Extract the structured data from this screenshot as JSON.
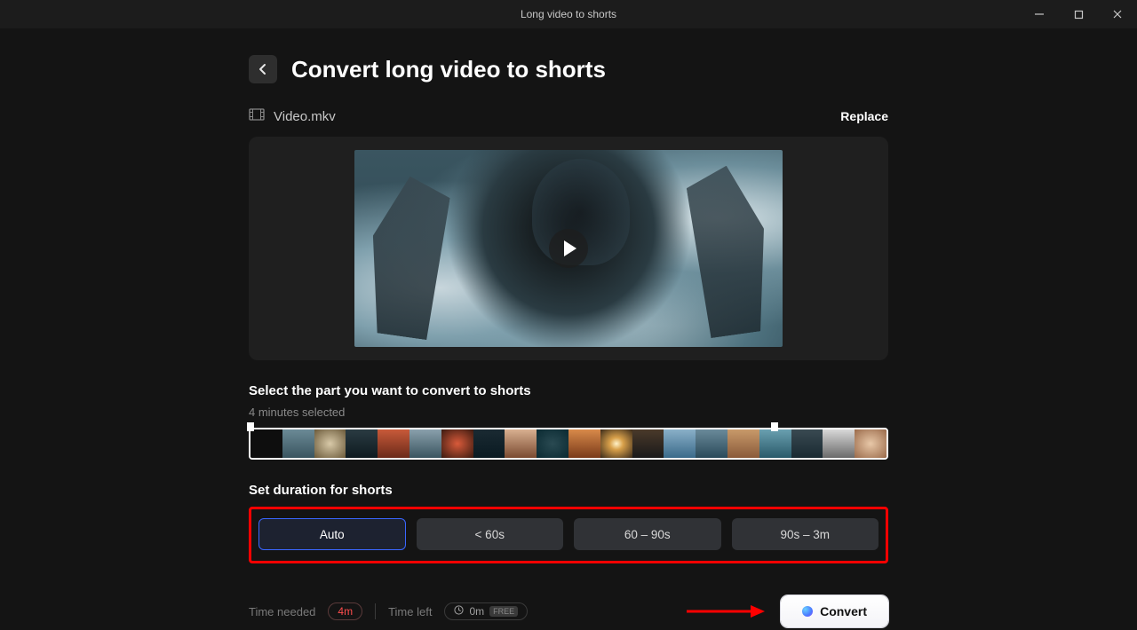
{
  "window": {
    "title": "Long video to shorts"
  },
  "header": {
    "title": "Convert long video to shorts"
  },
  "file": {
    "name": "Video.mkv",
    "replace_label": "Replace"
  },
  "select_section": {
    "label": "Select the part you want to convert to shorts",
    "subtext": "4 minutes selected"
  },
  "duration_section": {
    "label": "Set duration for shorts",
    "options": [
      "Auto",
      "< 60s",
      "60 – 90s",
      "90s – 3m"
    ],
    "selected_index": 0
  },
  "footer": {
    "time_needed_label": "Time needed",
    "time_needed_value": "4m",
    "time_left_label": "Time left",
    "time_left_value": "0m",
    "time_left_tag": "FREE",
    "convert_label": "Convert"
  }
}
